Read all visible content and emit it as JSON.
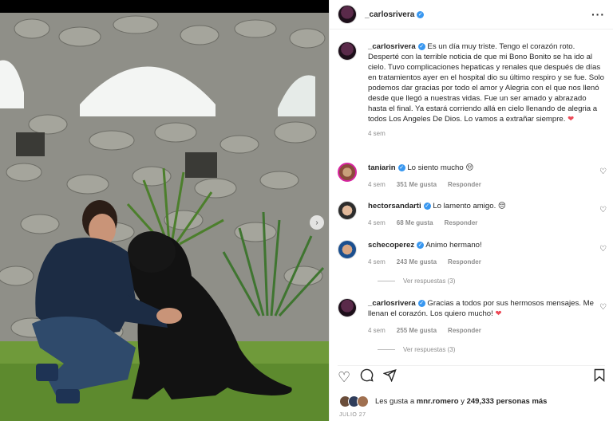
{
  "post": {
    "username": "_carlosrivera",
    "verified_icon": "verified-badge-icon",
    "more_icon": "more-dots-icon"
  },
  "caption": {
    "username": "_carlosrivera",
    "text": "Es un día muy triste. Tengo el corazón roto. Desperté con la terrible noticia de que mi Bono Bonito se ha ido al cielo. Tuvo complicaciones hepaticas y renales que después de días en tratamientos ayer en el hospital dio su último respiro y se fue. Solo podemos dar gracias por todo el amor y Alegria con el que nos llenó desde que llegó a nuestras vidas. Fue un ser amado y abrazado hasta el final. Ya estará corriendo allá en cielo llenando de alegria a todos Los Angeles De Dios. Lo vamos a extrañar siempre.",
    "time": "4 sem"
  },
  "comments": [
    {
      "username": "taniarin",
      "text": "Lo siento mucho 😔",
      "time": "4 sem",
      "likes": "351 Me gusta",
      "reply": "Responder"
    },
    {
      "username": "hectorsandarti",
      "text": "Lo lamento amigo. 😔",
      "time": "4 sem",
      "likes": "68 Me gusta",
      "reply": "Responder"
    },
    {
      "username": "schecoperez",
      "text": "Animo hermano!",
      "time": "4 sem",
      "likes": "243 Me gusta",
      "reply": "Responder",
      "view_replies": "Ver respuestas (3)"
    },
    {
      "username": "_carlosrivera",
      "text": "Gracias a todos por sus hermosos mensajes. Me llenan el corazón. Los quiero mucho!",
      "time": "4 sem",
      "likes": "255 Me gusta",
      "reply": "Responder",
      "view_replies": "Ver respuestas (3)"
    }
  ],
  "likes": {
    "prefix": "Les gusta a",
    "user": "mnr.romero",
    "connector": "y",
    "count": "249,333 personas más"
  },
  "date": "JULIO 27",
  "colors": {
    "verified": "#3897f0",
    "heart": "#ed4956",
    "muted": "#8e8e8e"
  }
}
